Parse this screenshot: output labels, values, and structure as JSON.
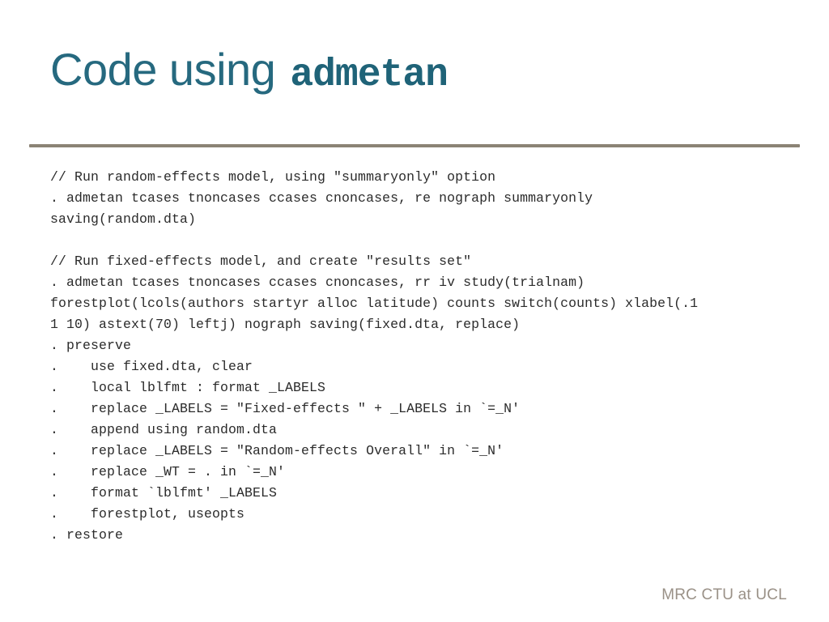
{
  "slide": {
    "title_plain": "Code using",
    "title_mono": "admetan",
    "accent_color": "#26697f",
    "divider_color": "#8b8375",
    "background_color": "#ffffff",
    "code_text_color": "#2b2b2b"
  },
  "code": {
    "lines": [
      {
        "text": "// Run random-effects model, using \"summaryonly\" option",
        "kind": "comment"
      },
      {
        "text": ". admetan tcases tnoncases ccases cnoncases, re nograph summaryonly",
        "kind": "command"
      },
      {
        "text": "saving(random.dta)",
        "kind": "continuation"
      },
      {
        "text": "",
        "kind": "blank"
      },
      {
        "text": "// Run fixed-effects model, and create \"results set\"",
        "kind": "comment"
      },
      {
        "text": ". admetan tcases tnoncases ccases cnoncases, rr iv study(trialnam)",
        "kind": "command"
      },
      {
        "text": "forestplot(lcols(authors startyr alloc latitude) counts switch(counts) xlabel(.1",
        "kind": "continuation"
      },
      {
        "text": "1 10) astext(70) leftj) nograph saving(fixed.dta, replace)",
        "kind": "continuation"
      },
      {
        "text": ". preserve",
        "kind": "command"
      },
      {
        "text": ".    use fixed.dta, clear",
        "kind": "command"
      },
      {
        "text": ".    local lblfmt : format _LABELS",
        "kind": "command"
      },
      {
        "text": ".    replace _LABELS = \"Fixed-effects \" + _LABELS in `=_N'",
        "kind": "command"
      },
      {
        "text": ".    append using random.dta",
        "kind": "command"
      },
      {
        "text": ".    replace _LABELS = \"Random-effects Overall\" in `=_N'",
        "kind": "command"
      },
      {
        "text": ".    replace _WT = . in `=_N'",
        "kind": "command"
      },
      {
        "text": ".    format `lblfmt' _LABELS",
        "kind": "command"
      },
      {
        "text": ".    forestplot, useopts",
        "kind": "command"
      },
      {
        "text": ". restore",
        "kind": "command"
      }
    ]
  },
  "footer": {
    "text": "MRC CTU at UCL",
    "color": "#9a9187"
  }
}
